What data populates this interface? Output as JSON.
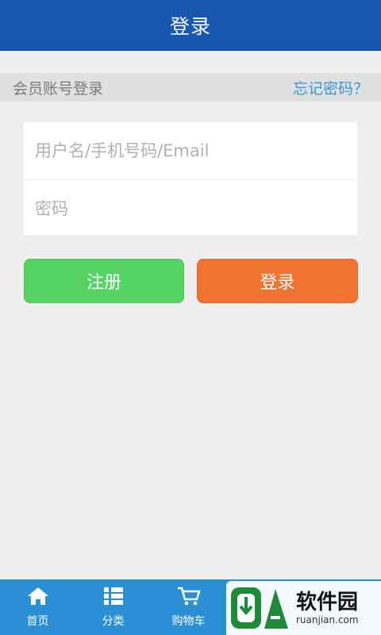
{
  "header": {
    "title": "登录"
  },
  "section": {
    "title": "会员账号登录",
    "forgot": "忘记密码？"
  },
  "form": {
    "username_placeholder": "用户名/手机号码/Email",
    "password_placeholder": "密码"
  },
  "buttons": {
    "register": "注册",
    "login": "登录"
  },
  "tabbar": {
    "items": [
      {
        "label": "首页",
        "icon": "home-icon"
      },
      {
        "label": "分类",
        "icon": "list-icon"
      },
      {
        "label": "购物车",
        "icon": "cart-icon"
      }
    ]
  },
  "watermark": {
    "text": "软件园",
    "url": "ruanjian.com"
  },
  "colors": {
    "header": "#1657b0",
    "tabbar": "#2b8fd6",
    "register": "#56d463",
    "login": "#f27331",
    "link": "#3a97d4"
  }
}
